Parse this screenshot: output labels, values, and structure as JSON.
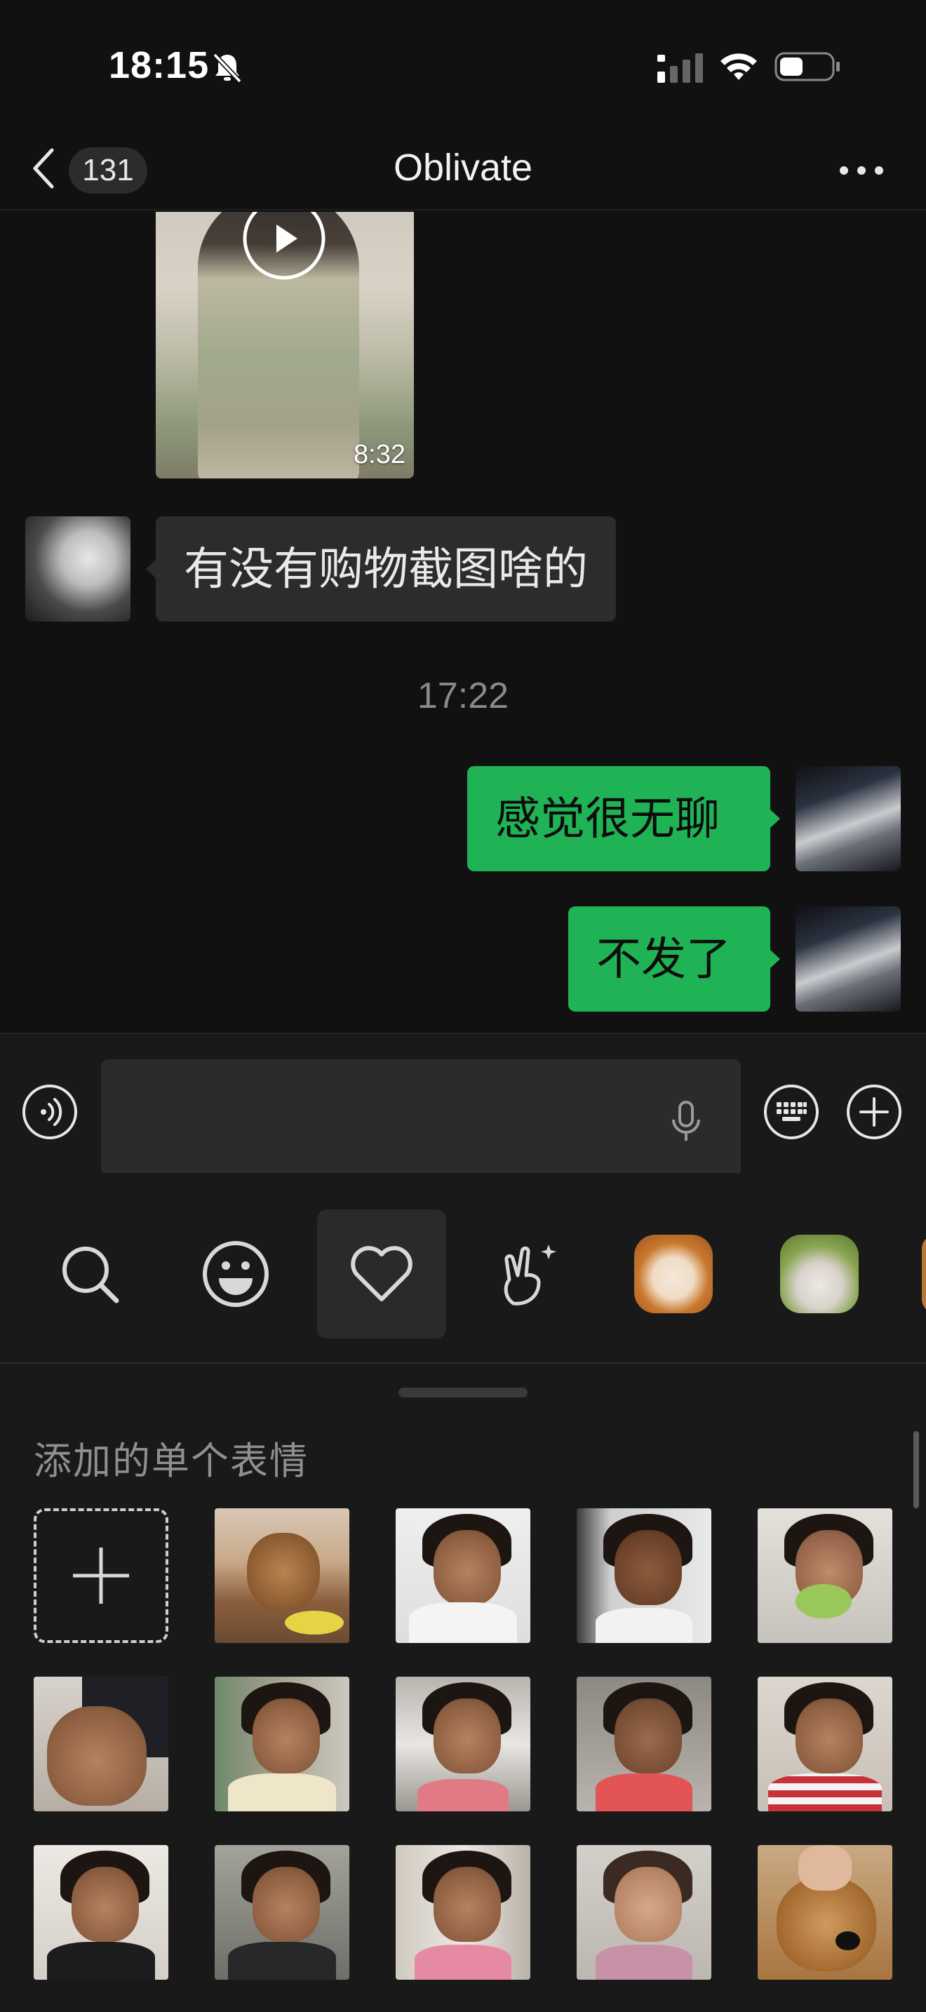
{
  "status_bar": {
    "time": "18:15",
    "battery_percent": 45
  },
  "header": {
    "back_unread_count": "131",
    "title": "Oblivate"
  },
  "messages": {
    "video": {
      "duration": "8:32"
    },
    "them_text": "有没有购物截图啥的",
    "time_separator": "17:22",
    "me_text_1": "感觉很无聊",
    "me_text_2": "不发了"
  },
  "sticker_panel": {
    "section_title": "添加的单个表情",
    "tabs": [
      "search-icon",
      "emoji-face-icon",
      "heart-icon",
      "victory-hand-icon",
      "dog-sticker",
      "frog-hat-sticker"
    ],
    "colors": {
      "accent_green": "#1fb356",
      "background": "#111111"
    }
  }
}
